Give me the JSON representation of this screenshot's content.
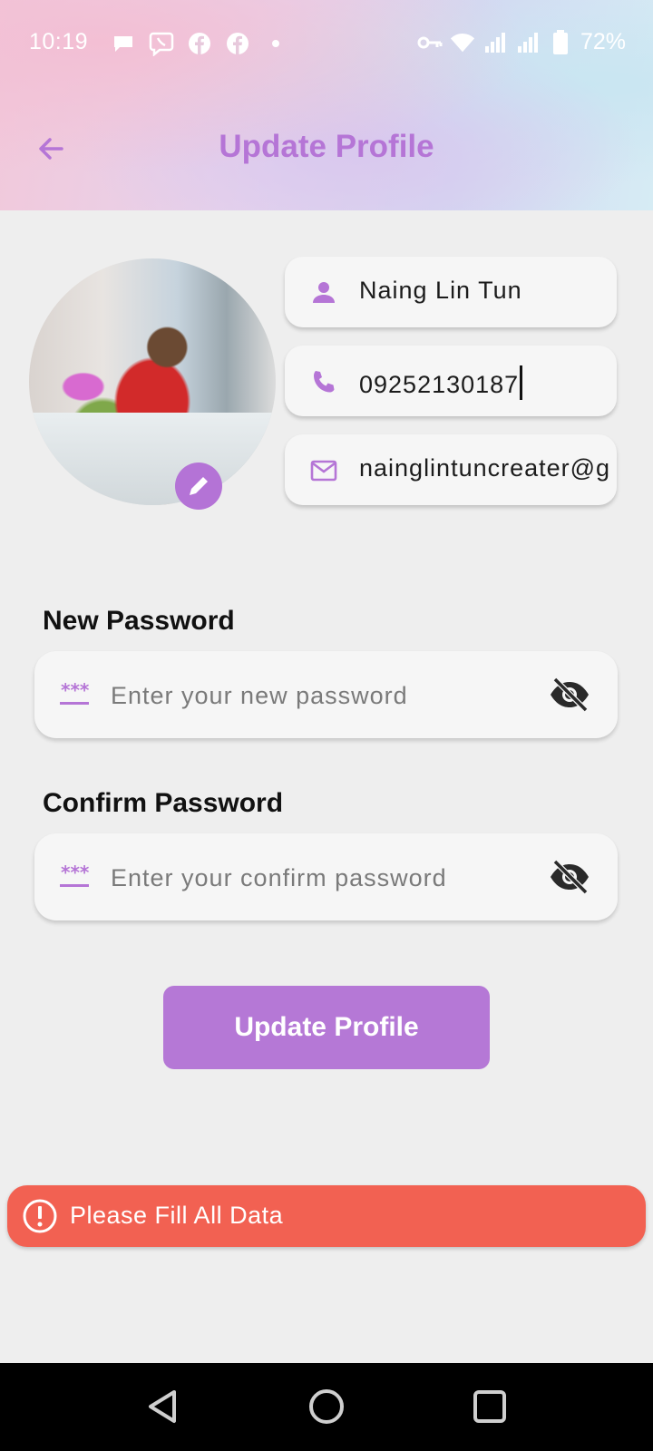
{
  "status_bar": {
    "time": "10:19",
    "battery": "72%",
    "left_icons": [
      "chat-bubble-icon",
      "viber-icon",
      "facebook-icon",
      "facebook-icon",
      "dot-icon"
    ],
    "right_icons": [
      "vpn-key-icon",
      "wifi-icon",
      "signal-icon",
      "signal-icon",
      "battery-icon"
    ]
  },
  "header": {
    "title": "Update Profile",
    "back_icon": "arrow-back-icon",
    "title_color": "#b575d6"
  },
  "profile": {
    "name": "Naing Lin Tun",
    "phone": "09252130187",
    "email": "nainglintuncreater@g",
    "edit_icon": "pencil-icon"
  },
  "password": {
    "new_label": "New Password",
    "new_placeholder": "Enter your new password",
    "confirm_label": "Confirm Password",
    "confirm_placeholder": "Enter your confirm password"
  },
  "actions": {
    "update_label": "Update Profile"
  },
  "snackbar": {
    "message": "Please Fill All Data",
    "color": "#f26152"
  },
  "colors": {
    "accent": "#b578d6",
    "background": "#eeeeee"
  }
}
